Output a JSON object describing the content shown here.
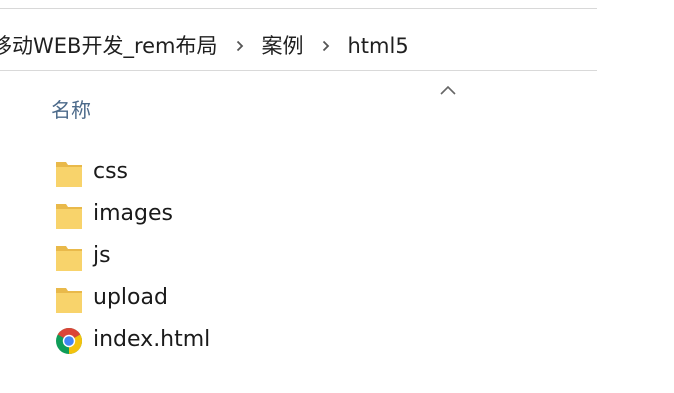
{
  "breadcrumb": {
    "items": [
      {
        "label": "移动WEB开发_rem布局"
      },
      {
        "label": "案例"
      },
      {
        "label": "html5"
      }
    ]
  },
  "columns": {
    "name_label": "名称",
    "sort": "ascending"
  },
  "files": [
    {
      "name": "css",
      "type": "folder",
      "icon": "folder-icon"
    },
    {
      "name": "images",
      "type": "folder",
      "icon": "folder-icon"
    },
    {
      "name": "js",
      "type": "folder",
      "icon": "folder-icon"
    },
    {
      "name": "upload",
      "type": "folder",
      "icon": "folder-icon"
    },
    {
      "name": "index.html",
      "type": "html",
      "icon": "chrome-icon"
    }
  ],
  "colors": {
    "folder": "#f8d36b",
    "folder_dark": "#e9b94a",
    "header_text": "#4c6a8a",
    "text": "#1a1a1a",
    "chrome_red": "#db4437",
    "chrome_yellow": "#f4c20d",
    "chrome_green": "#0f9d58",
    "chrome_blue": "#4285f4"
  }
}
